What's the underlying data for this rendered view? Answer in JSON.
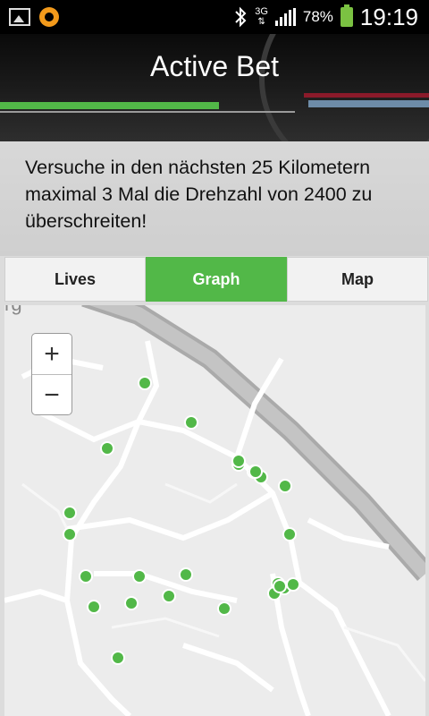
{
  "status_bar": {
    "network": "3G",
    "battery": "78%",
    "time": "19:19",
    "icons": [
      "image-icon",
      "app-notification-icon",
      "bluetooth-icon",
      "signal-icon",
      "battery-charging-icon"
    ]
  },
  "header": {
    "title": "Active Bet"
  },
  "description": "Versuche in den nächsten 25 Kilometern maximal 3 Mal die Drehzahl von 2400 zu überschreiten!",
  "tabs": [
    {
      "label": "Lives",
      "active": false
    },
    {
      "label": "Graph",
      "active": true
    },
    {
      "label": "Map",
      "active": false
    }
  ],
  "map": {
    "zoom_in": "+",
    "zoom_out": "−",
    "partial_label": "rg",
    "marker_color": "#52b848",
    "marker_count": 26
  },
  "colors": {
    "accent": "#52b848",
    "header_bg": "#111111",
    "map_bg": "#ececec"
  }
}
